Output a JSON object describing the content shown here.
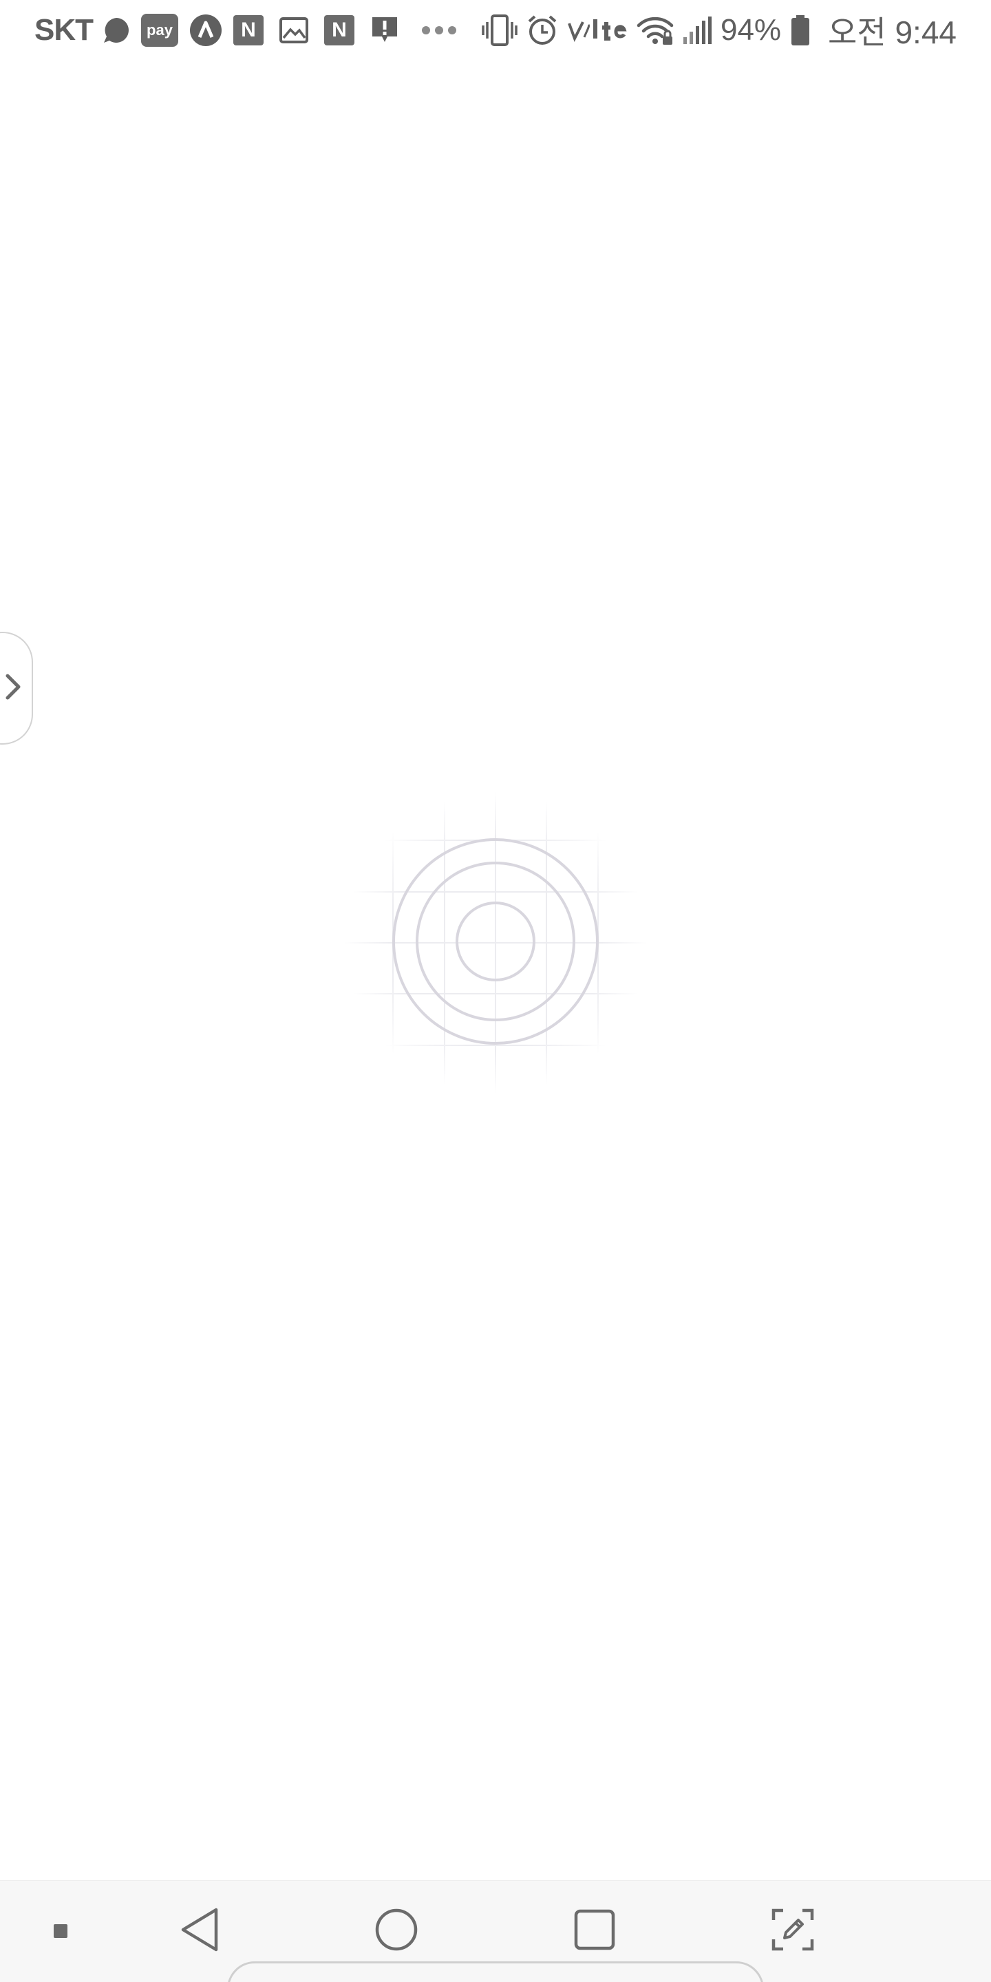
{
  "status_bar": {
    "carrier": "SKT",
    "pay_label": "pay",
    "n_label": "N",
    "battery_percent": "94%",
    "time": "오전 9:44",
    "icons": [
      "chat-bubble-icon",
      "pay-icon",
      "naver-icon",
      "n-icon",
      "image-icon",
      "n-icon",
      "alert-icon",
      "more-dots-icon",
      "vibrate-icon",
      "alarm-icon",
      "volte-icon",
      "wifi-icon",
      "signal-icon",
      "battery-icon"
    ]
  },
  "drawer": {
    "icon": "chevron-right-icon"
  },
  "loader": {
    "icon": "concentric-circles-icon"
  },
  "nav_bar": {
    "items": [
      "square-dot-icon",
      "back-icon",
      "home-icon",
      "recents-icon",
      "screenshot-edit-icon"
    ]
  },
  "colors": {
    "icon_gray": "#5f5f5f",
    "loader_ring": "#d8d6de",
    "grid_line": "#eeeeee",
    "nav_background": "#f7f7f7"
  }
}
